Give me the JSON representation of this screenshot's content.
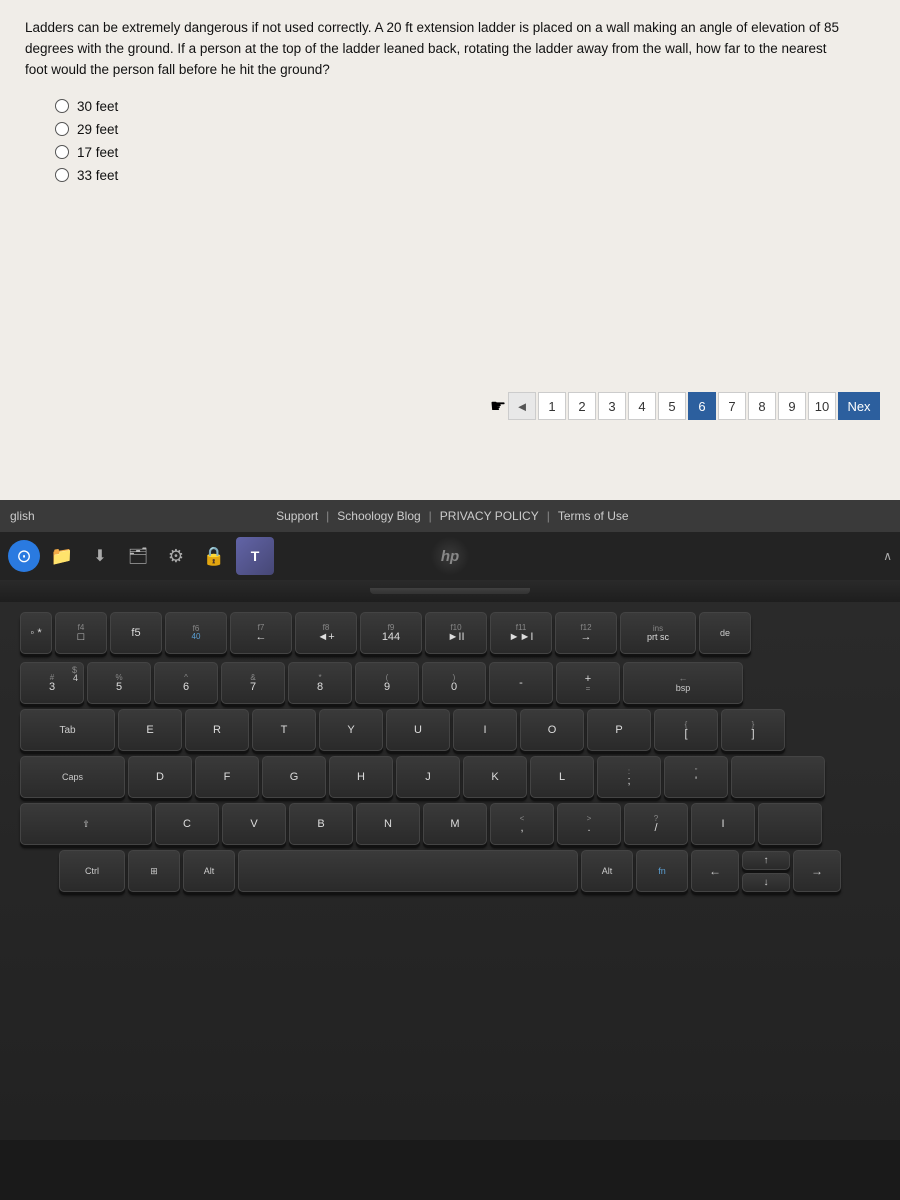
{
  "question": {
    "text_part1": "Ladders can be extremely dangerous if not used correctly. A 20 ft extension ladder is placed on a wall making an angle of elevation of 85 degrees with the ground. If a person at the top of the ladder leaned back, rotating the ladder away from the wall, how far to the nearest foot would the person fall before he hit the ground?",
    "options": [
      {
        "label": "30 feet"
      },
      {
        "label": "29 feet"
      },
      {
        "label": "17 feet"
      },
      {
        "label": "33 feet"
      }
    ]
  },
  "pagination": {
    "prev_arrow": "◄",
    "pages": [
      "1",
      "2",
      "3",
      "4",
      "5",
      "6",
      "7",
      "8",
      "9",
      "10"
    ],
    "active_page": "6",
    "next_label": "Nex"
  },
  "footer": {
    "left_text": "glish",
    "links": [
      {
        "label": "Support"
      },
      {
        "sep": "|"
      },
      {
        "label": "Schoology Blog"
      },
      {
        "sep": "|"
      },
      {
        "label": "PRIVACY POLICY"
      },
      {
        "sep": "|"
      },
      {
        "label": "Terms of Use"
      }
    ]
  },
  "keyboard": {
    "fn_row": [
      "*",
      "f4 □",
      "f5",
      "f6 40",
      "f7 ←",
      "f8 ◄+",
      "f9 144",
      "f10 ►II",
      "f11 ►►I",
      "f12 →",
      "ins prt sc",
      "de"
    ],
    "num_row": [
      "#3 $4",
      "%5",
      "^6",
      "&7",
      "*8",
      "(9",
      ")0",
      "-",
      "=",
      "← bsp"
    ],
    "row1": [
      "E",
      "R",
      "T",
      "Y",
      "U",
      "I",
      "O",
      "P",
      "[",
      "]"
    ],
    "row2": [
      "D",
      "F",
      "G",
      "H",
      "J",
      "K",
      "L",
      ";",
      "'"
    ],
    "row3": [
      "C",
      "V",
      "B",
      "N",
      "M",
      "<",
      ">",
      "?",
      "I"
    ],
    "hp_logo": "hp"
  }
}
